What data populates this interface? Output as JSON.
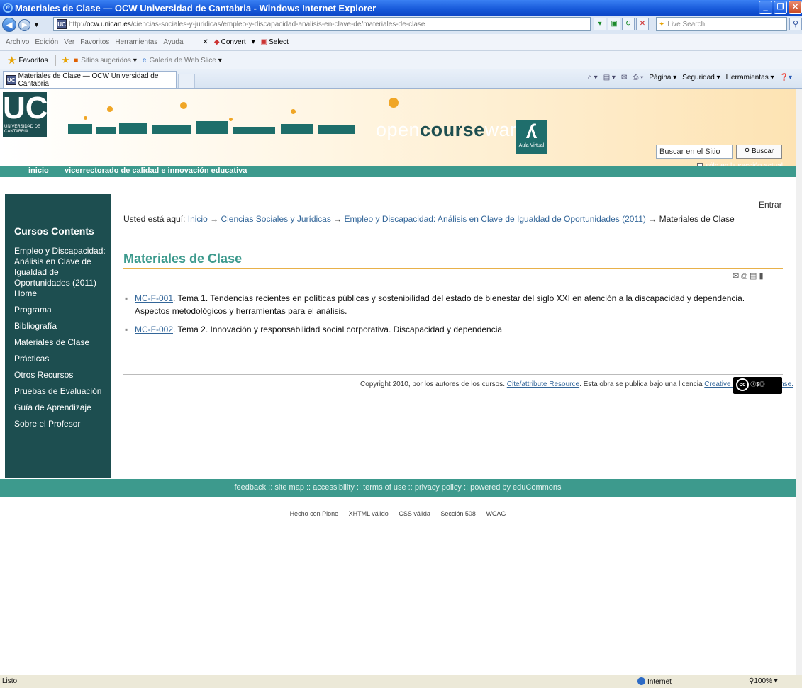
{
  "window": {
    "title": "Materiales de Clase — OCW Universidad de Cantabria - Windows Internet Explorer"
  },
  "address": {
    "host": "ocw.unican.es",
    "prefix": "http://",
    "path": "/ciencias-sociales-y-juridicas/empleo-y-discapacidad-analisis-en-clave-de/materiales-de-clase",
    "search_placeholder": "Live Search"
  },
  "menu": [
    "Archivo",
    "Edición",
    "Ver",
    "Favoritos",
    "Herramientas",
    "Ayuda"
  ],
  "toolbar": {
    "convert": "Convert",
    "select": "Select"
  },
  "favorites": {
    "label": "Favoritos",
    "suggested": "Sitios sugeridos",
    "gallery": "Galería de Web Slice"
  },
  "tab": {
    "title": "Materiales de Clase — OCW Universidad de Cantabria"
  },
  "commands": {
    "page": "Página",
    "security": "Seguridad",
    "tools": "Herramientas"
  },
  "site": {
    "logo_text": "UC",
    "logo_sub": "UNIVERSIDAD DE CANTABRIA",
    "brand_open": "open",
    "brand_course": "course",
    "brand_ware": "ware",
    "aula": "Aula Virtual",
    "search_value": "Buscar en el Sitio",
    "search_button": "Buscar",
    "search_section": "sólo en la sección actual",
    "nav_home": "inicio",
    "nav_vice": "vicerrectorado de calidad e innovación educativa",
    "login": "Entrar"
  },
  "sidebar": {
    "title": "Cursos Contents",
    "items": [
      {
        "label": "Empleo y Discapacidad: Análisis en Clave de Igualdad de Oportunidades (2011) Home"
      },
      {
        "label": "Programa"
      },
      {
        "label": "Bibliografía"
      },
      {
        "label": "Materiales de Clase"
      },
      {
        "label": "Prácticas"
      },
      {
        "label": "Otros Recursos"
      },
      {
        "label": "Pruebas de Evaluación"
      },
      {
        "label": "Guía de Aprendizaje"
      },
      {
        "label": "Sobre el Profesor"
      }
    ]
  },
  "breadcrumb": {
    "prefix": "Usted está aquí:",
    "home": "Inicio",
    "level1": "Ciencias Sociales y Jurídicas",
    "level2": "Empleo y Discapacidad: Análisis en Clave de Igualdad de Oportunidades (2011)",
    "current": "Materiales de Clase",
    "arrow": "→"
  },
  "page": {
    "title": "Materiales de Clase",
    "items": [
      {
        "code": "MC-F-001",
        "text": ". Tema 1. Tendencias recientes en políticas públicas y sostenibilidad del estado de bienestar del siglo XXI en atención a la discapacidad y dependencia. Aspectos metodológicos y herramientas para el análisis."
      },
      {
        "code": "MC-F-002",
        "text": ". Tema 2. Innovación y responsabilidad social corporativa. Discapacidad y dependencia"
      }
    ]
  },
  "copyright": {
    "text": "Copyright 2010, por los autores de los cursos.",
    "cite": "Cite/attribute Resource",
    "middle": ". Esta obra se publica bajo una licencia",
    "license": "Creative Commons License."
  },
  "footer": {
    "links": [
      "feedback",
      "site map",
      "accessibility",
      "terms of use",
      "privacy policy",
      "powered by eduCommons"
    ],
    "badges": [
      "Hecho con Plone",
      "XHTML válido",
      "CSS válida",
      "Sección 508",
      "WCAG"
    ]
  },
  "status": {
    "left": "Listo",
    "zone": "Internet",
    "zoom": "100%"
  }
}
